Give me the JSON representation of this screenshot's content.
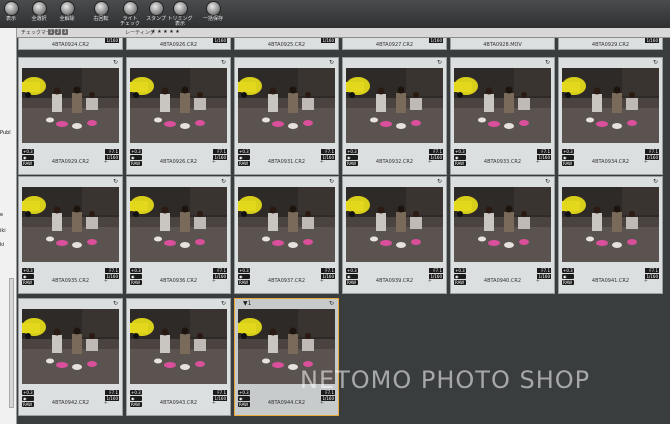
{
  "toolbar": {
    "items": [
      {
        "label": "表示",
        "icon": "view-icon"
      },
      {
        "label": "全選択",
        "icon": "select-all-icon"
      },
      {
        "label": "全解除",
        "icon": "deselect-all-icon"
      },
      {
        "label": "右回転",
        "icon": "rotate-right-icon"
      },
      {
        "label": "ライト\nチェック",
        "icon": "light-check-icon"
      },
      {
        "label": "スタンプ",
        "icon": "stamp-icon"
      },
      {
        "label": "トリミング\n表示",
        "icon": "trimming-icon"
      },
      {
        "label": "一括保存",
        "icon": "batch-save-icon"
      }
    ]
  },
  "filterbar": {
    "check_mark_label": "チェックマーク",
    "check_numbers": [
      "1",
      "2",
      "3"
    ],
    "rating_label": "レーティング",
    "rating_stars": "★ ★ ★ ★ ★"
  },
  "left_panel": {
    "texts": [
      "Publ",
      "e",
      "iki",
      "ki"
    ]
  },
  "top_partial": [
    {
      "filename": "4BTA0924.CR2",
      "badge": "1/160"
    },
    {
      "filename": "4BTA0926.CR2",
      "badge": "1/160"
    },
    {
      "filename": "4BTA0925.CR2",
      "badge": "1/160"
    },
    {
      "filename": "4BTA0927.CR2",
      "badge": "1/160"
    },
    {
      "filename": "4BTA0928.MOV",
      "badge": ""
    },
    {
      "filename": "4BTA0929.CR2",
      "badge": "1/160"
    }
  ],
  "thumbnails": [
    {
      "filename": "4BTA0929.CR2",
      "ev": "+0.3",
      "fstop": "F7.1",
      "shutter": "1/160",
      "raw": "RAW",
      "selected": false
    },
    {
      "filename": "4BTA0926.CR2",
      "ev": "+0.3",
      "fstop": "F7.1",
      "shutter": "1/160",
      "raw": "RAW",
      "selected": false
    },
    {
      "filename": "4BTA0931.CR2",
      "ev": "+0.3",
      "fstop": "F7.1",
      "shutter": "1/160",
      "raw": "RAW",
      "selected": false
    },
    {
      "filename": "4BTA0932.CR2",
      "ev": "+0.3",
      "fstop": "F7.1",
      "shutter": "1/160",
      "raw": "RAW",
      "selected": false
    },
    {
      "filename": "4BTA0933.CR2",
      "ev": "+0.3",
      "fstop": "F7.1",
      "shutter": "1/160",
      "raw": "RAW",
      "selected": false
    },
    {
      "filename": "4BTA0934.CR2",
      "ev": "+0.3",
      "fstop": "F7.1",
      "shutter": "1/160",
      "raw": "RAW",
      "selected": false
    },
    {
      "filename": "4BTA0935.CR2",
      "ev": "+0.3",
      "fstop": "F7.1",
      "shutter": "1/160",
      "raw": "RAW",
      "selected": false
    },
    {
      "filename": "4BTA0936.CR2",
      "ev": "+0.3",
      "fstop": "F7.1",
      "shutter": "1/160",
      "raw": "RAW",
      "selected": false
    },
    {
      "filename": "4BTA0937.CR2",
      "ev": "+0.3",
      "fstop": "F7.1",
      "shutter": "1/160",
      "raw": "RAW",
      "selected": false
    },
    {
      "filename": "4BTA0939.CR2",
      "ev": "+0.3",
      "fstop": "F7.1",
      "shutter": "1/160",
      "raw": "RAW",
      "selected": false
    },
    {
      "filename": "4BTA0940.CR2",
      "ev": "+0.3",
      "fstop": "F7.1",
      "shutter": "1/160",
      "raw": "RAW",
      "selected": false
    },
    {
      "filename": "4BTA0941.CR2",
      "ev": "+0.3",
      "fstop": "F7.1",
      "shutter": "1/160",
      "raw": "RAW",
      "selected": false
    },
    {
      "filename": "4BTA0942.CR2",
      "ev": "+0.3",
      "fstop": "F7.1",
      "shutter": "1/160",
      "raw": "RAW",
      "selected": false
    },
    {
      "filename": "4BTA0943.CR2",
      "ev": "+0.3",
      "fstop": "F7.1",
      "shutter": "1/160",
      "raw": "RAW",
      "selected": false
    },
    {
      "filename": "4BTA0944.CR2",
      "ev": "+0.3",
      "fstop": "F7.1",
      "shutter": "1/160",
      "raw": "RAW",
      "selected": true
    }
  ],
  "watermark": "NETOMO PHOTO SHOP"
}
